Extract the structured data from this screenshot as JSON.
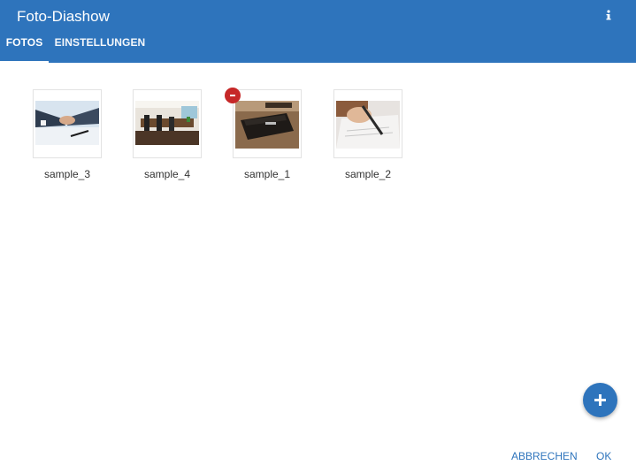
{
  "dialog": {
    "title": "Foto-Diashow",
    "info_icon": "info-icon",
    "accent_color": "#2e74bc",
    "tabs": [
      {
        "label": "FOTOS",
        "active": true
      },
      {
        "label": "EINSTELLUNGEN",
        "active": false
      }
    ]
  },
  "photos": [
    {
      "label": "sample_3",
      "image": "handshake-photo",
      "selected": false
    },
    {
      "label": "sample_4",
      "image": "meeting-room-photo",
      "selected": false
    },
    {
      "label": "sample_1",
      "image": "notebook-photo",
      "selected": true,
      "badge": "remove-icon"
    },
    {
      "label": "sample_2",
      "image": "signing-document-photo",
      "selected": false
    }
  ],
  "fab": {
    "icon": "plus-icon"
  },
  "actions": {
    "cancel_label": "ABBRECHEN",
    "ok_label": "OK"
  }
}
